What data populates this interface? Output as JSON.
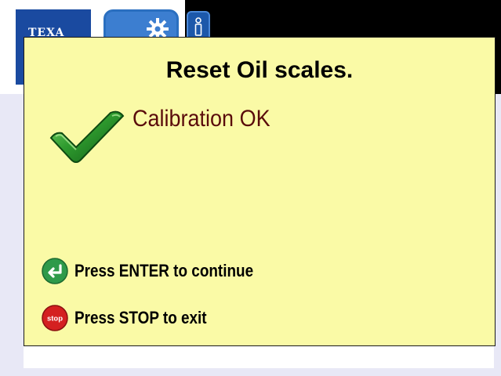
{
  "app": {
    "logo_text": "TEXA"
  },
  "dialog": {
    "title": "Reset Oil scales.",
    "status_message": "Calibration OK",
    "status_icon": "checkmark-icon",
    "status_color": "#5a0b0b",
    "background_color": "#fafaa6"
  },
  "instructions": [
    {
      "icon": "enter-icon",
      "icon_color": "#2e9a4a",
      "text": "Press ENTER to continue"
    },
    {
      "icon": "stop-icon",
      "icon_color": "#d42020",
      "icon_label": "STOP",
      "text": "Press STOP to exit"
    }
  ]
}
